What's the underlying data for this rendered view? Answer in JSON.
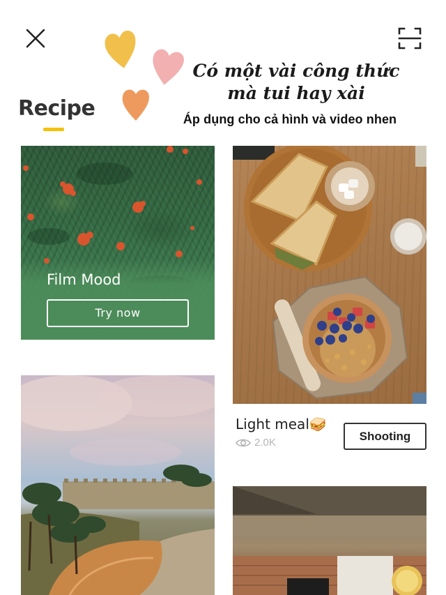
{
  "header": {
    "close_icon": "close-icon",
    "scan_icon": "scan-frame-icon"
  },
  "overlay": {
    "headline_line1": "Có một vài công thức",
    "headline_line2": "mà tui hay xài",
    "subline": "Áp dụng cho cả hình và video nhen",
    "heart_colors": [
      "#f0c04a",
      "#f2b0b0",
      "#ee9a5e"
    ]
  },
  "tabs": {
    "active_label": "Recipe",
    "indicator_color": "#f4c20d"
  },
  "cards": {
    "film": {
      "title": "Film Mood",
      "button_label": "Try now"
    },
    "meal": {
      "title": "Light meal",
      "emoji": "🥪",
      "views": "2.0K",
      "button_label": "Shooting"
    },
    "landscape": {},
    "cafe": {}
  }
}
